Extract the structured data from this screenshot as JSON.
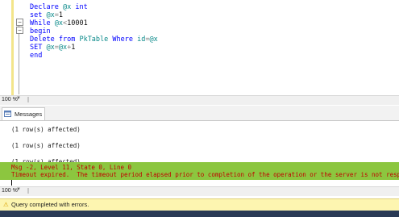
{
  "editor": {
    "lines": [
      {
        "parts": [
          {
            "t": "Declare",
            "c": "kw"
          },
          {
            "t": " ",
            "c": "txt"
          },
          {
            "t": "@x",
            "c": "var"
          },
          {
            "t": " ",
            "c": "txt"
          },
          {
            "t": "int",
            "c": "kw"
          }
        ]
      },
      {
        "parts": [
          {
            "t": "set",
            "c": "kw"
          },
          {
            "t": " ",
            "c": "txt"
          },
          {
            "t": "@x",
            "c": "var"
          },
          {
            "t": "=",
            "c": "op"
          },
          {
            "t": "1",
            "c": "num"
          }
        ]
      },
      {
        "parts": [
          {
            "t": "While",
            "c": "kw"
          },
          {
            "t": " ",
            "c": "txt"
          },
          {
            "t": "@x",
            "c": "var"
          },
          {
            "t": "<",
            "c": "op"
          },
          {
            "t": "10001",
            "c": "num"
          }
        ]
      },
      {
        "parts": [
          {
            "t": "begin",
            "c": "kw"
          }
        ]
      },
      {
        "parts": [
          {
            "t": "Delete",
            "c": "kw"
          },
          {
            "t": " ",
            "c": "txt"
          },
          {
            "t": "from",
            "c": "kw"
          },
          {
            "t": " ",
            "c": "txt"
          },
          {
            "t": "PkTable",
            "c": "var"
          },
          {
            "t": " ",
            "c": "txt"
          },
          {
            "t": "Where",
            "c": "kw"
          },
          {
            "t": " ",
            "c": "txt"
          },
          {
            "t": "id",
            "c": "var"
          },
          {
            "t": "=",
            "c": "op"
          },
          {
            "t": "@x",
            "c": "var"
          }
        ]
      },
      {
        "parts": [
          {
            "t": "SET",
            "c": "kw"
          },
          {
            "t": " ",
            "c": "txt"
          },
          {
            "t": "@x",
            "c": "var"
          },
          {
            "t": "=",
            "c": "op"
          },
          {
            "t": "@x",
            "c": "var"
          },
          {
            "t": "+",
            "c": "op"
          },
          {
            "t": "1",
            "c": "num"
          }
        ]
      },
      {
        "parts": [
          {
            "t": "end",
            "c": "kw"
          }
        ]
      }
    ],
    "fold_symbol": "−",
    "zoom": "100 %"
  },
  "results": {
    "tab_label": "Messages",
    "messages": [
      "(1 row(s) affected)",
      "(1 row(s) affected)",
      "(1 row(s) affected)"
    ],
    "error_lines": [
      "Msg -2, Level 11, State 0, Line 0",
      "Timeout expired.  The timeout period elapsed prior to completion of the operation or the server is not respo"
    ],
    "zoom": "100 %"
  },
  "status": {
    "warning_icon": "⚠",
    "text": "Query completed with errors."
  },
  "colors": {
    "error_band": "#8cc63f",
    "status_bar": "#fdf5b0",
    "keyword": "#0000ff",
    "variable": "#0a8a8a"
  }
}
